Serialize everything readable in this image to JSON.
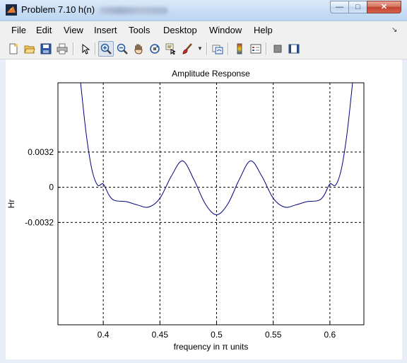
{
  "window": {
    "title": "Problem 7.10 h(n)",
    "controls": {
      "minimize": "—",
      "maximize": "□",
      "close": "✕"
    }
  },
  "menubar": {
    "items": [
      "File",
      "Edit",
      "View",
      "Insert",
      "Tools",
      "Desktop",
      "Window",
      "Help"
    ]
  },
  "toolbar": {
    "buttons": [
      "new-figure-icon",
      "open-file-icon",
      "save-icon",
      "print-icon",
      "edit-plot-arrow-icon",
      "zoom-in-icon",
      "zoom-out-icon",
      "pan-hand-icon",
      "rotate-3d-icon",
      "data-cursor-icon",
      "brush-icon",
      "link-plot-icon",
      "colorbar-icon",
      "legend-icon",
      "hide-plot-tools-icon",
      "show-plot-tools-icon"
    ],
    "pressed": "zoom-in-icon"
  },
  "chart_data": {
    "type": "line",
    "title": "Amplitude Response",
    "xlabel": "frequency in π units",
    "ylabel": "Hr",
    "xlim": [
      0.36,
      0.63
    ],
    "ylim": [
      -0.0125,
      0.0095
    ],
    "xticks": [
      0.4,
      0.45,
      0.5,
      0.55,
      0.6
    ],
    "xtick_labels": [
      "0.4",
      "0.45",
      "0.5",
      "0.55",
      "0.6"
    ],
    "yticks": [
      -0.0032,
      0,
      0.0032
    ],
    "ytick_labels": [
      "-0.0032",
      "0",
      "0.0032"
    ],
    "grid": "dashed at tick positions",
    "line_color": "#00007f",
    "series": [
      {
        "x": [
          0.38,
          0.385,
          0.39,
          0.395,
          0.4,
          0.405,
          0.41,
          0.42,
          0.43,
          0.44,
          0.45,
          0.46,
          0.47,
          0.48,
          0.49,
          0.5,
          0.51,
          0.52,
          0.53,
          0.54,
          0.55,
          0.56,
          0.57,
          0.58,
          0.59,
          0.595,
          0.6,
          0.605,
          0.61,
          0.615,
          0.62
        ],
        "y": [
          0.0095,
          0.0048,
          0.0016,
          0.0002,
          0.0003,
          -0.0007,
          -0.0012,
          -0.0013,
          -0.0016,
          -0.0018,
          -0.001,
          0.001,
          0.0024,
          0.0007,
          -0.0015,
          -0.0025,
          -0.0015,
          0.0007,
          0.0024,
          0.001,
          -0.001,
          -0.0018,
          -0.0016,
          -0.0013,
          -0.0012,
          -0.0007,
          0.0003,
          0.0002,
          0.0016,
          0.0048,
          0.0095
        ]
      }
    ]
  }
}
